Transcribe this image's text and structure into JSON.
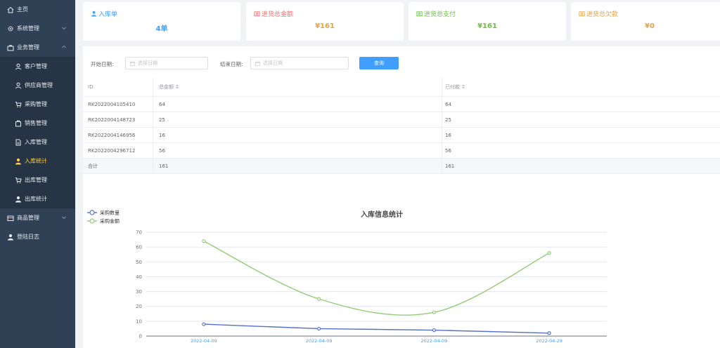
{
  "sidebar": {
    "items": [
      {
        "label": "主页",
        "icon": "home-icon"
      },
      {
        "label": "系统管理",
        "icon": "gear-icon",
        "arrow": "chevron-down-icon"
      },
      {
        "label": "业务管理",
        "icon": "briefcase-icon",
        "arrow": "chevron-up-icon"
      }
    ],
    "sub_items": [
      {
        "label": "客户管理",
        "icon": "user-icon"
      },
      {
        "label": "供应商管理",
        "icon": "supplier-icon"
      },
      {
        "label": "采购管理",
        "icon": "cart-icon"
      },
      {
        "label": "销售管理",
        "icon": "sales-icon"
      },
      {
        "label": "入库管理",
        "icon": "document-icon"
      },
      {
        "label": "入库统计",
        "icon": "user-stat-icon",
        "active": true
      },
      {
        "label": "出库管理",
        "icon": "cart-icon"
      },
      {
        "label": "出库统计",
        "icon": "user-stat-icon"
      }
    ],
    "bottom_items": [
      {
        "label": "商品管理",
        "icon": "goods-icon",
        "arrow": "chevron-down-icon"
      },
      {
        "label": "登陆日志",
        "icon": "user-icon"
      }
    ],
    "active_color": "#ffd04b",
    "bg_color": "#304156"
  },
  "cards": [
    {
      "title": "入库单",
      "value": "4单",
      "icon": "user-icon",
      "color": "#409eff"
    },
    {
      "title": "进货总金额",
      "value": "¥161",
      "icon": "money-icon",
      "color": "#e6a23c"
    },
    {
      "title": "进货总支付",
      "value": "¥161",
      "icon": "money-icon",
      "color": "#67c23a"
    },
    {
      "title": "进货总欠款",
      "value": "¥0",
      "icon": "money-icon",
      "color": "#e6a23c"
    }
  ],
  "filter": {
    "start_label": "开始日期:",
    "start_placeholder": "选择日期",
    "end_label": "结束日期:",
    "end_placeholder": "选择日期",
    "query_button": "查询"
  },
  "table": {
    "columns": [
      "ID",
      "总金额",
      "已付款"
    ],
    "rows": [
      [
        "RK2022004105410",
        "64",
        "64"
      ],
      [
        "RK2022004148723",
        "25",
        "25"
      ],
      [
        "RK2022004146956",
        "16",
        "16"
      ],
      [
        "RK2022004296712",
        "56",
        "56"
      ]
    ],
    "total_row": [
      "合计",
      "161",
      "161"
    ]
  },
  "chart_data": {
    "type": "line",
    "title": "入库信息统计",
    "legend_position": "top-left",
    "categories": [
      "2022-04-09",
      "2022-04-09",
      "2022-04-09",
      "2022-04-29"
    ],
    "series": [
      {
        "name": "采购数量",
        "values": [
          8,
          5,
          4,
          2
        ],
        "color": "#5470c6",
        "smooth": false
      },
      {
        "name": "采购金额",
        "values": [
          64,
          25,
          16,
          56
        ],
        "color": "#91cc75",
        "smooth": true
      }
    ],
    "ylim": [
      0,
      70
    ],
    "yticks": [
      0,
      10,
      20,
      30,
      40,
      50,
      60,
      70
    ],
    "grid": true
  }
}
